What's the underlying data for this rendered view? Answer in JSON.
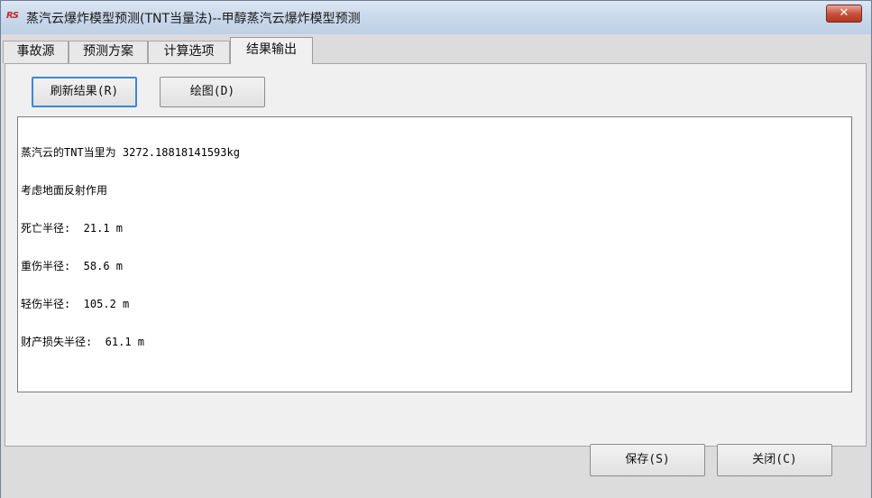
{
  "window": {
    "app_icon_text": "RS",
    "title": "蒸汽云爆炸模型预测(TNT当量法)--甲醇蒸汽云爆炸模型预测",
    "close_glyph": "✕"
  },
  "tabs": [
    {
      "label": "事故源",
      "active": false
    },
    {
      "label": "预测方案",
      "active": false
    },
    {
      "label": "计算选项",
      "active": false
    },
    {
      "label": "结果输出",
      "active": true
    }
  ],
  "result_panel": {
    "refresh_label": "刷新结果(R)",
    "plot_label": "绘图(D)",
    "output_lines": [
      "蒸汽云的TNT当里为 3272.18818141593kg",
      "考虑地面反射作用",
      "死亡半径:  21.1 m",
      "重伤半径:  58.6 m",
      "轻伤半径:  105.2 m",
      "财产损失半径:  61.1 m"
    ]
  },
  "footer": {
    "save_label": "保存(S)",
    "close_label": "关闭(C)"
  }
}
